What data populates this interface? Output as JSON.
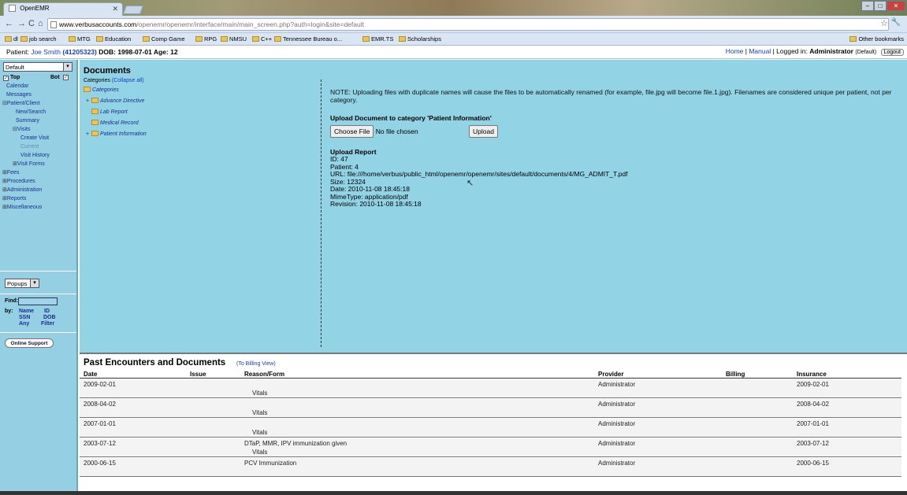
{
  "browser": {
    "tab_title": "OpenEMR",
    "url_host": "www.verbusaccounts.com",
    "url_path": "/openemr/openemr/interface/main/main_screen.php?auth=login&site=default",
    "bookmarks": [
      "dl",
      "job search",
      "MTG",
      "Education",
      "Comp Game",
      "RPG",
      "NMSU",
      "C++",
      "Tennessee Bureau o...",
      "EMR.TS",
      "Scholarships"
    ],
    "other_bookmarks": "Other bookmarks"
  },
  "top": {
    "patient_label": "Patient:",
    "patient_name": "Joe Smith",
    "patient_id": "(41205323)",
    "dob": "DOB: 1998-07-01 Age: 12",
    "home": "Home",
    "manual": "Manual",
    "logged_in": "| Logged in:",
    "user": "Administrator",
    "site": "(Default)",
    "logout": "Logout"
  },
  "nav": {
    "layout_select": "Default",
    "top_label": "Top",
    "bot_label": "Bot",
    "items": [
      "Calendar",
      "Messages",
      "Patient/Client",
      "New/Search",
      "Summary",
      "Visits",
      "Create Visit",
      "Current",
      "Visit History",
      "Visit Forms",
      "Fees",
      "Procedures",
      "Administration",
      "Reports",
      "Miscellaneous"
    ],
    "popups_select": "Popups",
    "find_label": "Find:",
    "by_label": "by:",
    "search_by": [
      "Name",
      "ID",
      "SSN",
      "DOB",
      "Any",
      "Filter"
    ],
    "online_support": "Online Support"
  },
  "documents": {
    "title": "Documents",
    "categories_label": "Categories",
    "collapse_all": "(Collapse all)",
    "tree_root": "Categories",
    "tree_items": [
      "Advance Directive",
      "Lab Report",
      "Medical Record",
      "Patient Information"
    ],
    "note": "NOTE: Uploading files with duplicate names will cause the files to be automatically renamed (for example, file.jpg will become file.1.jpg). Filenames are considered unique per patient, not per category.",
    "upload_heading": "Upload Document to category 'Patient Information'",
    "choose_file": "Choose File",
    "no_file": "No file chosen",
    "upload_btn": "Upload",
    "report_heading": "Upload Report",
    "report": {
      "id": "ID: 47",
      "patient": "Patient: 4",
      "url": "URL: file:///home/verbus/public_html/openemr/openemr/sites/default/documents/4/MG_ADMIT_T.pdf",
      "size": "Size: 12324",
      "date": "Date: 2010-11-08 18:45:18",
      "mime": "MimeType: application/pdf",
      "revision": "Revision: 2010-11-08 18:45:18"
    }
  },
  "encounters": {
    "title": "Past Encounters and Documents",
    "billing_view": "(To Billing View)",
    "headers": [
      "Date",
      "Issue",
      "Reason/Form",
      "Provider",
      "Billing",
      "Insurance"
    ],
    "rows": [
      {
        "date": "2009-02-01",
        "reason": "",
        "form": "Vitals",
        "provider": "Administrator",
        "insurance": "2009-02-01"
      },
      {
        "date": "2008-04-02",
        "reason": "",
        "form": "Vitals",
        "provider": "Administrator",
        "insurance": "2008-04-02"
      },
      {
        "date": "2007-01-01",
        "reason": "",
        "form": "Vitals",
        "provider": "Administrator",
        "insurance": "2007-01-01"
      },
      {
        "date": "2003-07-12",
        "reason": "DTaP, MMR, IPV immunization given",
        "form": "Vitals",
        "provider": "Administrator",
        "insurance": "2003-07-12"
      },
      {
        "date": "2000-06-15",
        "reason": "PCV Immunization",
        "form": "",
        "provider": "Administrator",
        "insurance": "2000-06-15"
      }
    ]
  }
}
